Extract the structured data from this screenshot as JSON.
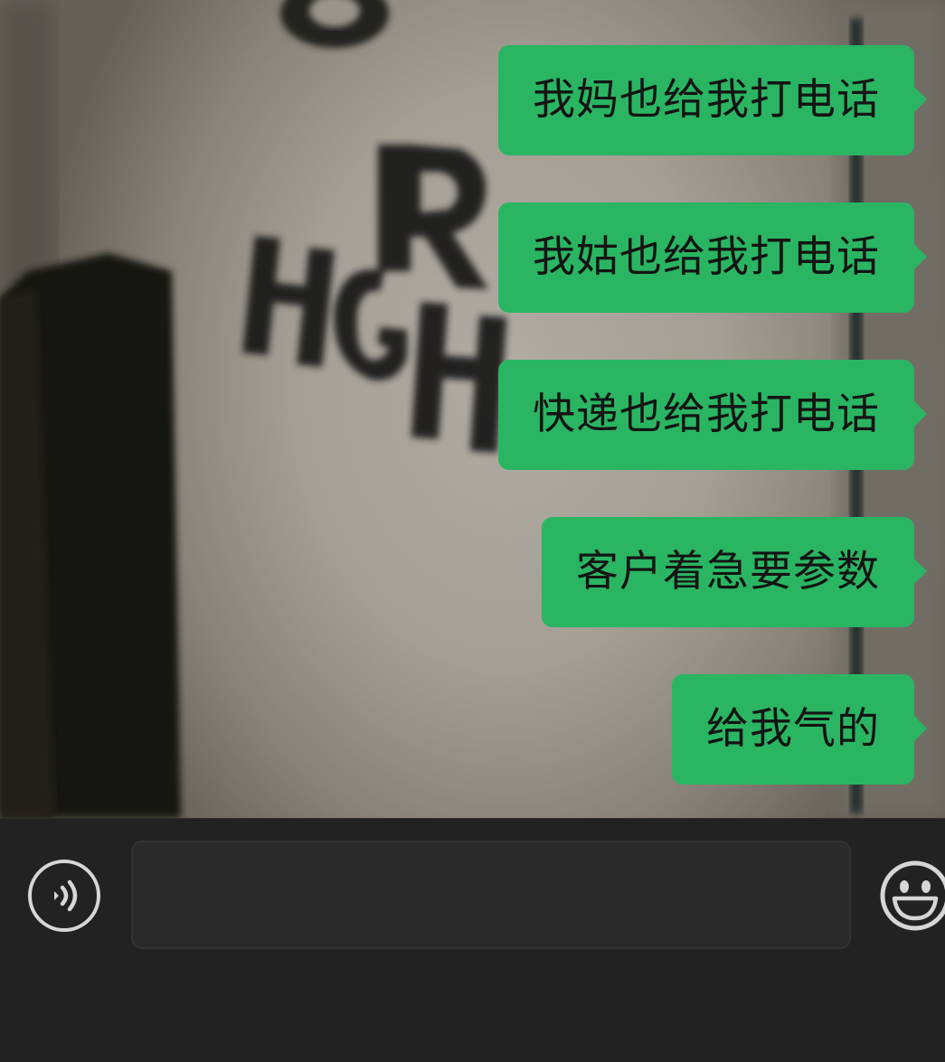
{
  "chat": {
    "messages": [
      {
        "sender": "me",
        "text": "我妈也给我打电话"
      },
      {
        "sender": "me",
        "text": "我姑也给我打电话"
      },
      {
        "sender": "me",
        "text": "快递也给我打电话"
      },
      {
        "sender": "me",
        "text": "客户着急要参数"
      },
      {
        "sender": "me",
        "text": "给我气的"
      }
    ],
    "bubble_color": "#2ab562",
    "wallpaper_text": "R HGH"
  },
  "input_bar": {
    "voice_icon": "voice-icon",
    "message_value": "",
    "emoji_icon": "emoji-icon",
    "background_color": "#222222"
  }
}
